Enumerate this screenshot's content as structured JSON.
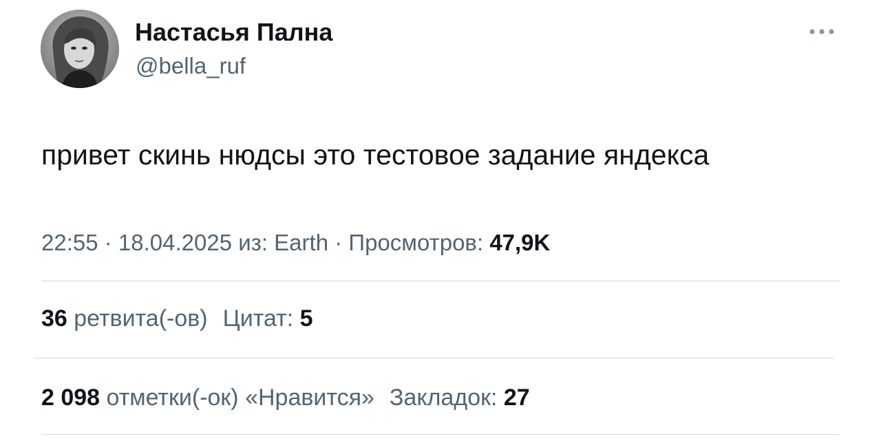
{
  "author": {
    "display_name": "Настасья Пална",
    "handle": "@bella_ruf",
    "avatar_icon": "user-avatar"
  },
  "menu": {
    "icon": "more-horizontal-icon"
  },
  "tweet": {
    "text": "привет скинь нюдсы это тестовое задание яндекса"
  },
  "meta": {
    "time": "22:55",
    "separator": " · ",
    "date": "18.04.2025",
    "source_prefix": " из: ",
    "source": "Earth",
    "views_label": "Просмотров: ",
    "views_value": "47,9K"
  },
  "stats": {
    "retweets_count": "36",
    "retweets_label": " ретвита(-ов)",
    "quotes_label": "Цитат: ",
    "quotes_count": "5",
    "likes_count": "2 098",
    "likes_label": " отметки(-ок) «Нравится»",
    "bookmarks_label": "Закладок: ",
    "bookmarks_count": "27"
  },
  "colors": {
    "text_primary": "#0f1419",
    "text_secondary": "#536471",
    "divider": "#cfd9de"
  }
}
